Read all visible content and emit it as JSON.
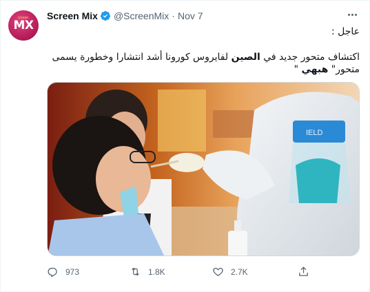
{
  "tweet": {
    "author": {
      "name": "Screen Mix",
      "handle": "@ScreenMix",
      "separator": "·",
      "date": "Nov 7",
      "avatar_text": "MX"
    },
    "text_line1": "عاجل :",
    "text_line2_part1": "اكتشاف متحور جديد في ",
    "text_line2_bold1": "الصين",
    "text_line2_part2": " لفايروس كورونا أشد انتشارا وخطورة يسمى متحور\" ",
    "text_line2_bold2": "هبهي",
    "text_line2_part3": " \"",
    "media": {
      "description_icon": "photo",
      "shield_label": "IELD"
    },
    "actions": {
      "replies": "973",
      "retweets": "1.8K",
      "likes": "2.7K"
    },
    "colors": {
      "brand": "#1d9bf0",
      "avatar": "#c2185b",
      "muted": "#536471"
    }
  }
}
